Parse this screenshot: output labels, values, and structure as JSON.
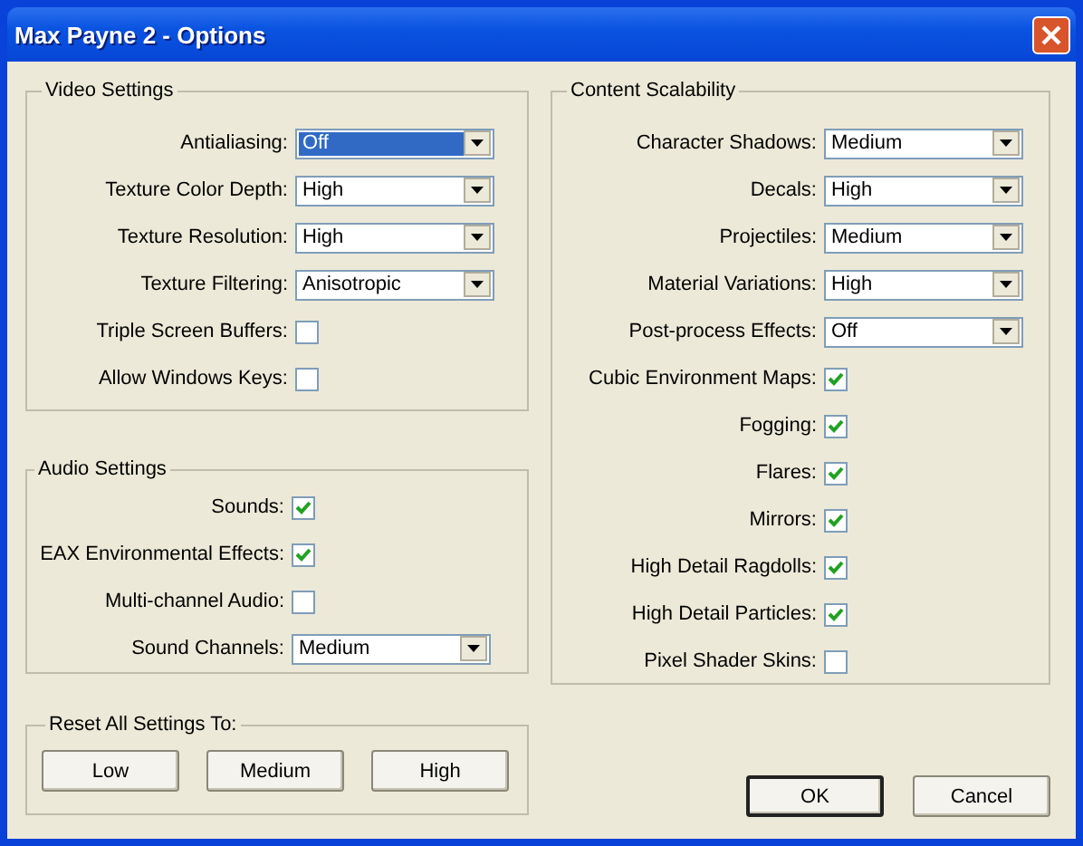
{
  "window": {
    "title": "Max Payne 2 - Options"
  },
  "video_settings": {
    "title": "Video Settings",
    "rows": [
      {
        "kind": "dropdown",
        "label": "Antialiasing:",
        "value": "Off",
        "focused": true
      },
      {
        "kind": "dropdown",
        "label": "Texture Color Depth:",
        "value": "High",
        "focused": false
      },
      {
        "kind": "dropdown",
        "label": "Texture Resolution:",
        "value": "High",
        "focused": false
      },
      {
        "kind": "dropdown",
        "label": "Texture Filtering:",
        "value": "Anisotropic",
        "focused": false
      },
      {
        "kind": "checkbox",
        "label": "Triple Screen Buffers:",
        "checked": false
      },
      {
        "kind": "checkbox",
        "label": "Allow Windows Keys:",
        "checked": false
      }
    ]
  },
  "audio_settings": {
    "title": "Audio Settings",
    "rows": [
      {
        "kind": "checkbox",
        "label": "Sounds:",
        "checked": true
      },
      {
        "kind": "checkbox",
        "label": "EAX Environmental Effects:",
        "checked": true
      },
      {
        "kind": "checkbox",
        "label": "Multi-channel Audio:",
        "checked": false
      },
      {
        "kind": "dropdown",
        "label": "Sound Channels:",
        "value": "Medium",
        "focused": false
      }
    ]
  },
  "reset": {
    "title": "Reset All Settings To:",
    "buttons": [
      "Low",
      "Medium",
      "High"
    ]
  },
  "content_scalability": {
    "title": "Content Scalability",
    "rows": [
      {
        "kind": "dropdown",
        "label": "Character Shadows:",
        "value": "Medium",
        "focused": false
      },
      {
        "kind": "dropdown",
        "label": "Decals:",
        "value": "High",
        "focused": false
      },
      {
        "kind": "dropdown",
        "label": "Projectiles:",
        "value": "Medium",
        "focused": false
      },
      {
        "kind": "dropdown",
        "label": "Material Variations:",
        "value": "High",
        "focused": false
      },
      {
        "kind": "dropdown",
        "label": "Post-process Effects:",
        "value": "Off",
        "focused": false
      },
      {
        "kind": "checkbox",
        "label": "Cubic Environment Maps:",
        "checked": true
      },
      {
        "kind": "checkbox",
        "label": "Fogging:",
        "checked": true
      },
      {
        "kind": "checkbox",
        "label": "Flares:",
        "checked": true
      },
      {
        "kind": "checkbox",
        "label": "Mirrors:",
        "checked": true
      },
      {
        "kind": "checkbox",
        "label": "High Detail Ragdolls:",
        "checked": true
      },
      {
        "kind": "checkbox",
        "label": "High Detail Particles:",
        "checked": true
      },
      {
        "kind": "checkbox",
        "label": "Pixel Shader Skins:",
        "checked": false
      }
    ]
  },
  "buttons": [
    {
      "label": "OK",
      "default": true
    },
    {
      "label": "Cancel",
      "default": false
    }
  ]
}
